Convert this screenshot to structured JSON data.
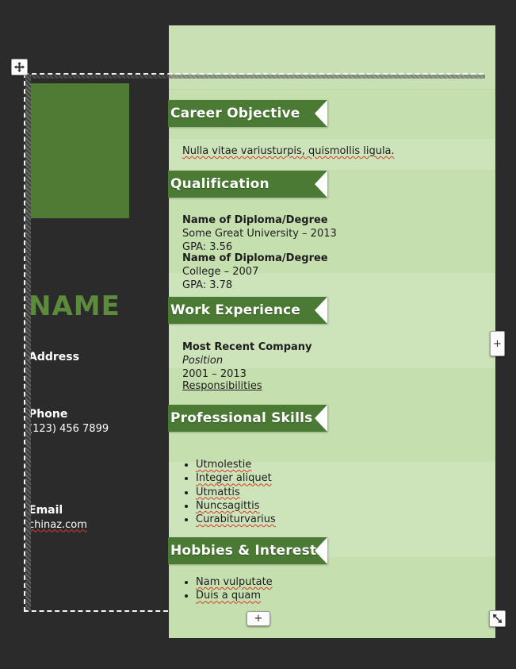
{
  "editor": {
    "handles": {
      "move": "move-handle",
      "add_right": "+",
      "add_bottom": "+",
      "resize": "resize-handle"
    }
  },
  "sidebar": {
    "photo_placeholder": "",
    "name": "NAME",
    "contacts": [
      {
        "label": "Address",
        "value": ""
      },
      {
        "label": "Phone",
        "value": "(123) 456 7899"
      },
      {
        "label": "Email",
        "value": "chinaz.com"
      }
    ]
  },
  "sections": [
    {
      "title": "Career Objective",
      "paragraph": "Nulla vitae variusturpis, quismollis ligula."
    },
    {
      "title": "Qualification",
      "entries": [
        {
          "heading": "Name of Diploma/Degree",
          "line1": "Some Great University – 2013",
          "line2": "GPA: 3.56"
        },
        {
          "heading": "Name of Diploma/Degree",
          "line1": "College – 2007",
          "line2": "GPA: 3.78"
        }
      ]
    },
    {
      "title": "Work Experience",
      "company": "Most Recent Company",
      "position": "Position",
      "dates": "2001 – 2013",
      "link": "Responsibilities"
    },
    {
      "title": "Professional Skills",
      "skills": [
        "Utmolestie",
        "Integer aliquet",
        "Utmattis",
        "Nuncsagittis",
        "Curabiturvarius"
      ]
    },
    {
      "title": "Hobbies & Interests",
      "hobbies": [
        "Nam vulputate",
        "Duis a quam"
      ]
    }
  ],
  "colors": {
    "canvas_bg": "#2b2b2b",
    "panel_bg": "#c9e0b4",
    "ribbon_green": "#4a7a33",
    "name_green": "#5c8b3c",
    "photo_green": "#4f7b35",
    "fold_orange": "#ef8b33",
    "text_dark": "#1d1d1d",
    "spellcheck_red": "#d83a2a"
  }
}
